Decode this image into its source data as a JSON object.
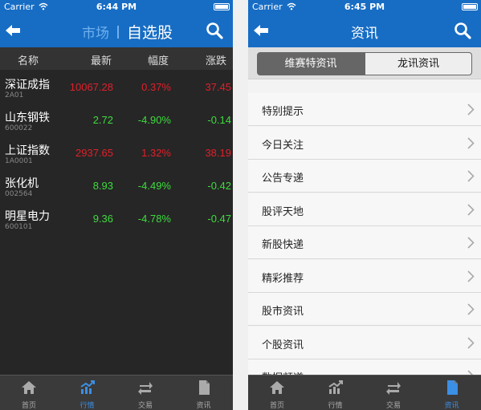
{
  "status_left": {
    "carrier": "Carrier",
    "time": "6:44 PM"
  },
  "status_right": {
    "carrier": "Carrier",
    "time": "6:45 PM"
  },
  "market": {
    "tab_market": "市场",
    "tab_watchlist": "自选股",
    "columns": [
      "名称",
      "最新",
      "幅度",
      "涨跌"
    ],
    "rows": [
      {
        "name": "深证成指",
        "code": "2A01",
        "price": "10067.28",
        "pct": "0.37%",
        "change": "37.45",
        "trend": "up"
      },
      {
        "name": "山东钢铁",
        "code": "600022",
        "price": "2.72",
        "pct": "-4.90%",
        "change": "-0.14",
        "trend": "down"
      },
      {
        "name": "上证指数",
        "code": "1A0001",
        "price": "2937.65",
        "pct": "1.32%",
        "change": "38.19",
        "trend": "up"
      },
      {
        "name": "张化机",
        "code": "002564",
        "price": "8.93",
        "pct": "-4.49%",
        "change": "-0.42",
        "trend": "down"
      },
      {
        "name": "明星电力",
        "code": "600101",
        "price": "9.36",
        "pct": "-4.78%",
        "change": "-0.47",
        "trend": "down"
      }
    ]
  },
  "news": {
    "title": "资讯",
    "segments": [
      "维赛特资讯",
      "龙讯资讯"
    ],
    "items": [
      "特别提示",
      "今日关注",
      "公告专递",
      "股评天地",
      "新股快递",
      "精彩推荐",
      "股市资讯",
      "个股资讯",
      "数据频道"
    ]
  },
  "tabs": [
    "首页",
    "行情",
    "交易",
    "资讯"
  ],
  "colors": {
    "nav_blue": "#176dc4",
    "up_red": "#e0202a",
    "down_green": "#3ddc3d",
    "tab_active": "#3b8fe4"
  }
}
